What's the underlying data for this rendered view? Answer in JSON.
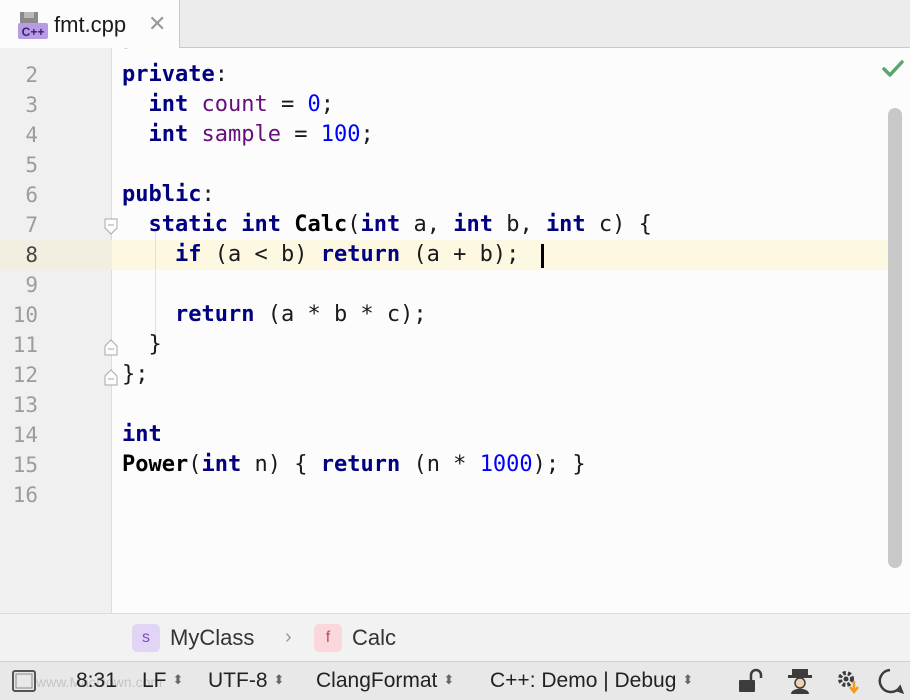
{
  "tab": {
    "label": "fmt.cpp",
    "icon": "cpp-file-icon",
    "icon_text": "C++",
    "close": "✕"
  },
  "editor": {
    "partial_top": "};",
    "line_numbers": [
      "2",
      "3",
      "4",
      "5",
      "6",
      "7",
      "8",
      "9",
      "10",
      "11",
      "12",
      "13",
      "14",
      "15",
      "16"
    ],
    "current_line": "8"
  },
  "code": {
    "l2": {
      "kw": "private",
      "rest": ":"
    },
    "l3": {
      "kw": "int",
      "fld": "count",
      "op": " = ",
      "num": "0",
      "end": ";"
    },
    "l4": {
      "kw": "int",
      "fld": "sample",
      "op": " = ",
      "num": "100",
      "end": ";"
    },
    "l6": {
      "kw": "public",
      "rest": ":"
    },
    "l7": {
      "kw1": "static",
      "kw2": "int",
      "fn": "Calc",
      "p1": "(",
      "kw3": "int",
      "a": " a, ",
      "kw4": "int",
      "b": " b, ",
      "kw5": "int",
      "c": " c) {"
    },
    "l8": {
      "kw1": "if",
      "mid": " (a < b) ",
      "kw2": "return",
      "end": " (a + b);"
    },
    "l10": {
      "kw": "return",
      "end": " (a * b * c);"
    },
    "l11": {
      "text": "}"
    },
    "l12": {
      "text": "};"
    },
    "l14": {
      "kw": "int"
    },
    "l15": {
      "fn": "Power",
      "p1": "(",
      "kw1": "int",
      "n": " n) { ",
      "kw2": "return",
      "mid": " (n * ",
      "num": "1000",
      "end": "); }"
    }
  },
  "breadcrumbs": [
    {
      "badge": "s",
      "label": "MyClass",
      "badge_bg": "#e1d4f5",
      "badge_color": "#7a4cc2"
    },
    {
      "badge": "f",
      "label": "Calc",
      "badge_bg": "#f9d7dc",
      "badge_color": "#c44a5e"
    }
  ],
  "breadcrumb_sep": "›",
  "status": {
    "position": "8:31",
    "line_sep": "LF",
    "encoding": "UTF-8",
    "formatter": "ClangFormat",
    "context": "C++: Demo | Debug",
    "arrows": "⬍",
    "watermark": "www.MacDown.com"
  },
  "colors": {
    "keyword": "#000080",
    "field": "#660e7a",
    "number": "#0000ff",
    "caret_line": "#fdf8e2",
    "check": "#59a869"
  }
}
